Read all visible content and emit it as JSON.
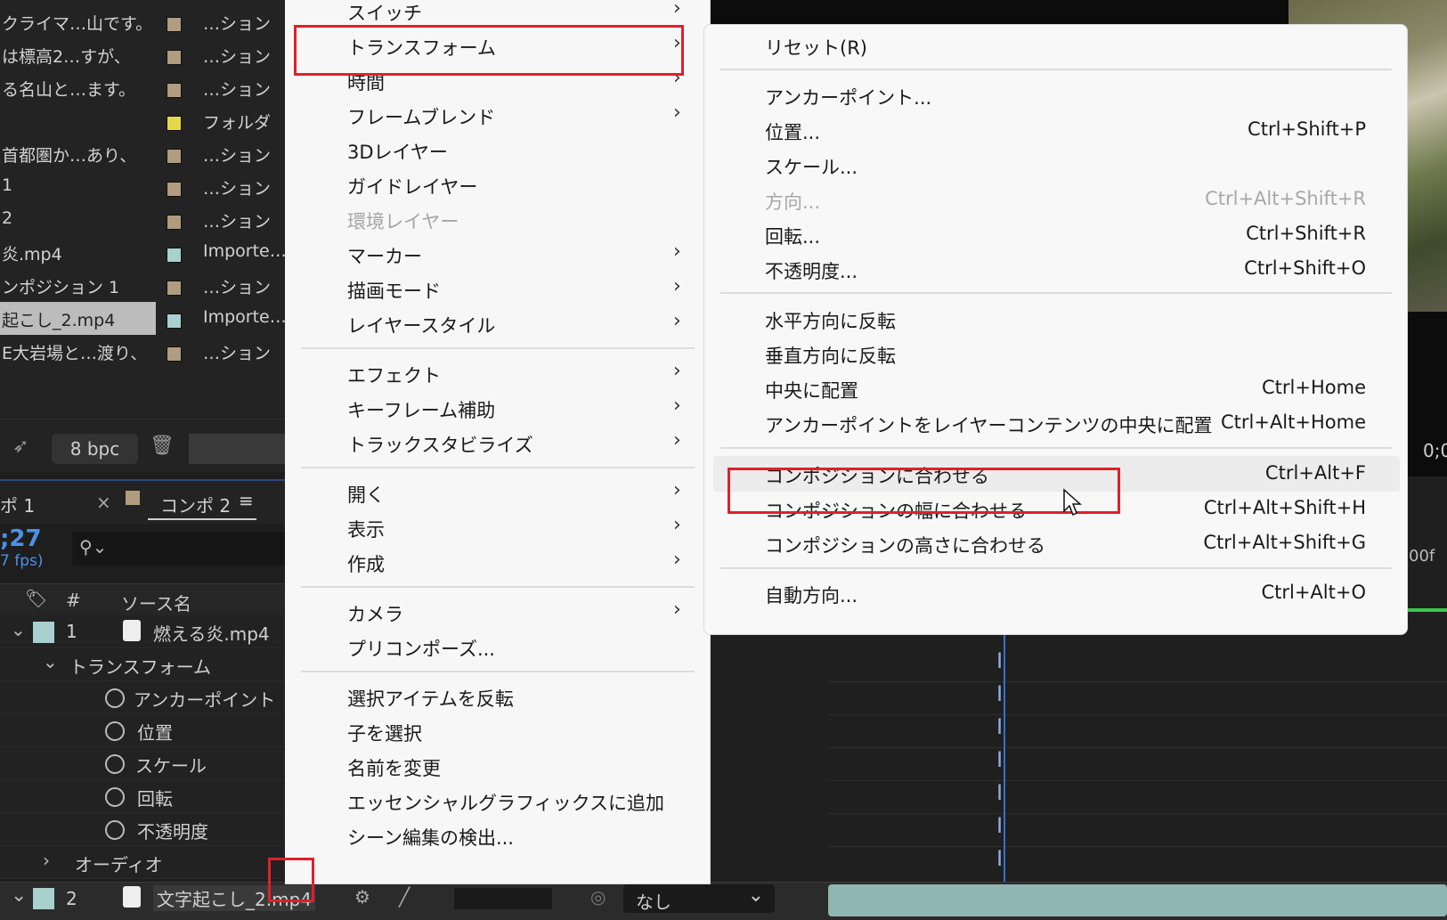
{
  "project": {
    "rows": [
      {
        "name": "クライマ…山です。",
        "type": "…ション",
        "swatch": "#b09c7e"
      },
      {
        "name": "は標高2…すが、",
        "type": "…ション",
        "swatch": "#b09c7e"
      },
      {
        "name": "る名山と…ます。",
        "type": "…ション",
        "swatch": "#b09c7e"
      },
      {
        "name": "",
        "type": "フォルダ",
        "swatch": "#e3d84a"
      },
      {
        "name": "首都圏か…あり、",
        "type": "…ション",
        "swatch": "#b09c7e"
      },
      {
        "name": "1",
        "type": "…ション",
        "swatch": "#b09c7e"
      },
      {
        "name": "2",
        "type": "…ション",
        "swatch": "#b09c7e"
      },
      {
        "name": "炎.mp4",
        "type": "Importe…",
        "swatch": "#a8d0cf"
      },
      {
        "name": "ンポジション 1",
        "type": "…ション",
        "swatch": "#b09c7e"
      },
      {
        "name": "起こし_2.mp4",
        "type": "Importe…",
        "swatch": "#a8d0cf",
        "selected": true
      },
      {
        "name": "E大岩場と…渡り、",
        "type": "…ション",
        "swatch": "#b09c7e"
      }
    ],
    "bpc_label": "8 bpc"
  },
  "timeline": {
    "tab1": "ポ 1",
    "tab_close": "×",
    "tab2": "コンポ 2",
    "tab_menu": "≡",
    "timecode": ";27",
    "fps": "7 fps)",
    "header_tag": "🏷",
    "header_num": "#",
    "header_source": "ソース名",
    "layer1": {
      "num": "1",
      "name": "燃える炎.mp4"
    },
    "transform_label": "トランスフォーム",
    "props": [
      "アンカーポイント",
      "位置",
      "スケール",
      "回転",
      "不透明度"
    ],
    "audio_label": "オーディオ",
    "layer2": {
      "num": "2",
      "name": "文字起こし_2.mp4"
    },
    "parent_value": "なし",
    "right_snippet": "00f",
    "right_time": "0;0"
  },
  "context_menu": {
    "items": [
      {
        "label": "スイッチ",
        "arrow": true
      },
      {
        "label": "トランスフォーム",
        "arrow": true,
        "highlight": true
      },
      {
        "label": "時間",
        "arrow": true
      },
      {
        "label": "フレームブレンド",
        "arrow": true
      },
      {
        "label": "3Dレイヤー"
      },
      {
        "label": "ガイドレイヤー"
      },
      {
        "label": "環境レイヤー",
        "disabled": true
      },
      {
        "label": "マーカー",
        "arrow": true
      },
      {
        "label": "描画モード",
        "arrow": true
      },
      {
        "label": "レイヤースタイル",
        "arrow": true
      },
      {
        "label": "エフェクト",
        "arrow": true
      },
      {
        "label": "キーフレーム補助",
        "arrow": true
      },
      {
        "label": "トラックスタビライズ",
        "arrow": true
      },
      {
        "label": "開く",
        "arrow": true
      },
      {
        "label": "表示",
        "arrow": true
      },
      {
        "label": "作成",
        "arrow": true
      },
      {
        "label": "カメラ",
        "arrow": true
      },
      {
        "label": "プリコンポーズ..."
      },
      {
        "label": "選択アイテムを反転"
      },
      {
        "label": "子を選択"
      },
      {
        "label": "名前を変更"
      },
      {
        "label": "エッセンシャルグラフィックスに追加"
      },
      {
        "label": "シーン編集の検出..."
      }
    ],
    "arrow_glyph": "›"
  },
  "submenu": {
    "items": [
      {
        "label": "リセット(R)",
        "shortcut": ""
      },
      {
        "label": "アンカーポイント...",
        "shortcut": ""
      },
      {
        "label": "位置...",
        "shortcut": "Ctrl+Shift+P"
      },
      {
        "label": "スケール...",
        "shortcut": ""
      },
      {
        "label": "方向...",
        "shortcut": "Ctrl+Alt+Shift+R",
        "disabled": true
      },
      {
        "label": "回転...",
        "shortcut": "Ctrl+Shift+R"
      },
      {
        "label": "不透明度...",
        "shortcut": "Ctrl+Shift+O"
      },
      {
        "label": "水平方向に反転",
        "shortcut": ""
      },
      {
        "label": "垂直方向に反転",
        "shortcut": ""
      },
      {
        "label": "中央に配置",
        "shortcut": "Ctrl+Home"
      },
      {
        "label": "アンカーポイントをレイヤーコンテンツの中央に配置",
        "shortcut": "Ctrl+Alt+Home"
      },
      {
        "label": "コンポジションに合わせる",
        "shortcut": "Ctrl+Alt+F",
        "hovered": true
      },
      {
        "label": "コンポジションの幅に合わせる",
        "shortcut": "Ctrl+Alt+Shift+H"
      },
      {
        "label": "コンポジションの高さに合わせる",
        "shortcut": "Ctrl+Alt+Shift+G"
      },
      {
        "label": "自動方向...",
        "shortcut": "Ctrl+Alt+O"
      }
    ]
  },
  "colors": {
    "highlight_box": "#e0202a",
    "accent_blue": "#4d8fe8",
    "menu_bg": "#f7f7f7"
  }
}
